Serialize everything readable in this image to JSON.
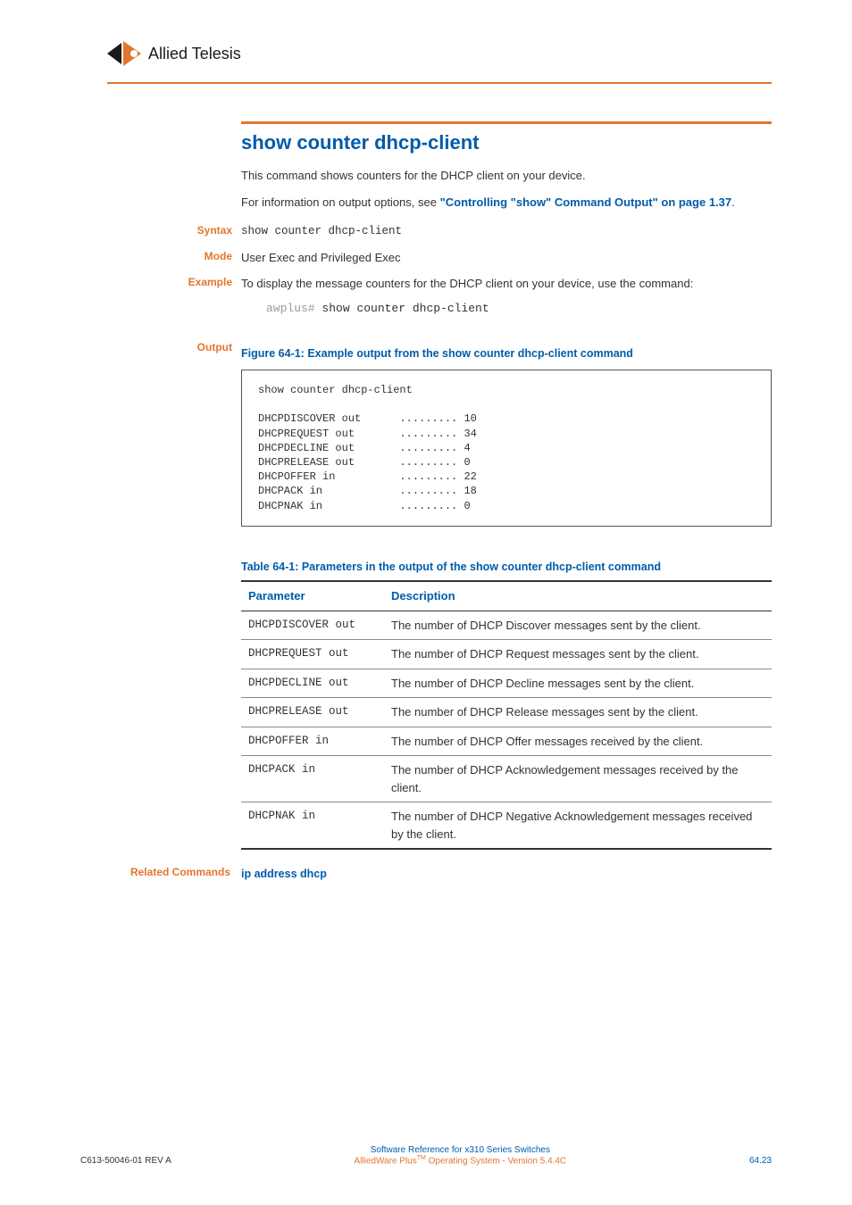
{
  "logo_text": "Allied Telesis",
  "title": "show counter dhcp-client",
  "intro1": "This command shows counters for the DHCP client on your device.",
  "intro2_pre": "For information on output options, see ",
  "intro2_link": "\"Controlling \"show\" Command Output\" on page 1.37",
  "intro2_post": ".",
  "labels": {
    "syntax": "Syntax",
    "mode": "Mode",
    "example": "Example",
    "output": "Output",
    "related": "Related Commands"
  },
  "syntax_cmd": "show counter dhcp-client",
  "mode_text": "User Exec and Privileged Exec",
  "example_text": "To display the message counters for the DHCP client on your device, use the command:",
  "example_prompt": "awplus#",
  "example_cmd": "show counter dhcp-client",
  "fig_caption": "Figure 64-1: Example output from the show counter dhcp-client command",
  "output_block": "show counter dhcp-client\n\nDHCPDISCOVER out      ......... 10\nDHCPREQUEST out       ......... 34\nDHCPDECLINE out       ......... 4\nDHCPRELEASE out       ......... 0\nDHCPOFFER in          ......... 22\nDHCPACK in            ......... 18\nDHCPNAK in            ......... 0",
  "tbl_caption": "Table 64-1: Parameters in the output of the show counter dhcp-client command",
  "table": {
    "h1": "Parameter",
    "h2": "Description",
    "rows": [
      {
        "p": "DHCPDISCOVER out",
        "d": "The number of DHCP Discover messages sent by the client."
      },
      {
        "p": "DHCPREQUEST out",
        "d": "The number of DHCP Request messages sent by the client."
      },
      {
        "p": "DHCPDECLINE out",
        "d": "The number of DHCP Decline messages sent by the client."
      },
      {
        "p": "DHCPRELEASE out",
        "d": "The number of DHCP Release messages sent by the client."
      },
      {
        "p": "DHCPOFFER in",
        "d": "The number of DHCP Offer messages received by the client."
      },
      {
        "p": "DHCPACK in",
        "d": "The number of DHCP Acknowledgement messages received by the client."
      },
      {
        "p": "DHCPNAK in",
        "d": "The number of DHCP Negative Acknowledgement messages received by the client."
      }
    ]
  },
  "related_link": "ip address dhcp",
  "footer": {
    "left": "C613-50046-01 REV A",
    "center1": "Software Reference for x310 Series Switches",
    "center2_pre": "AlliedWare Plus",
    "center2_tm": "TM",
    "center2_post": " Operating System - Version 5.4.4C",
    "right": "64.23"
  }
}
